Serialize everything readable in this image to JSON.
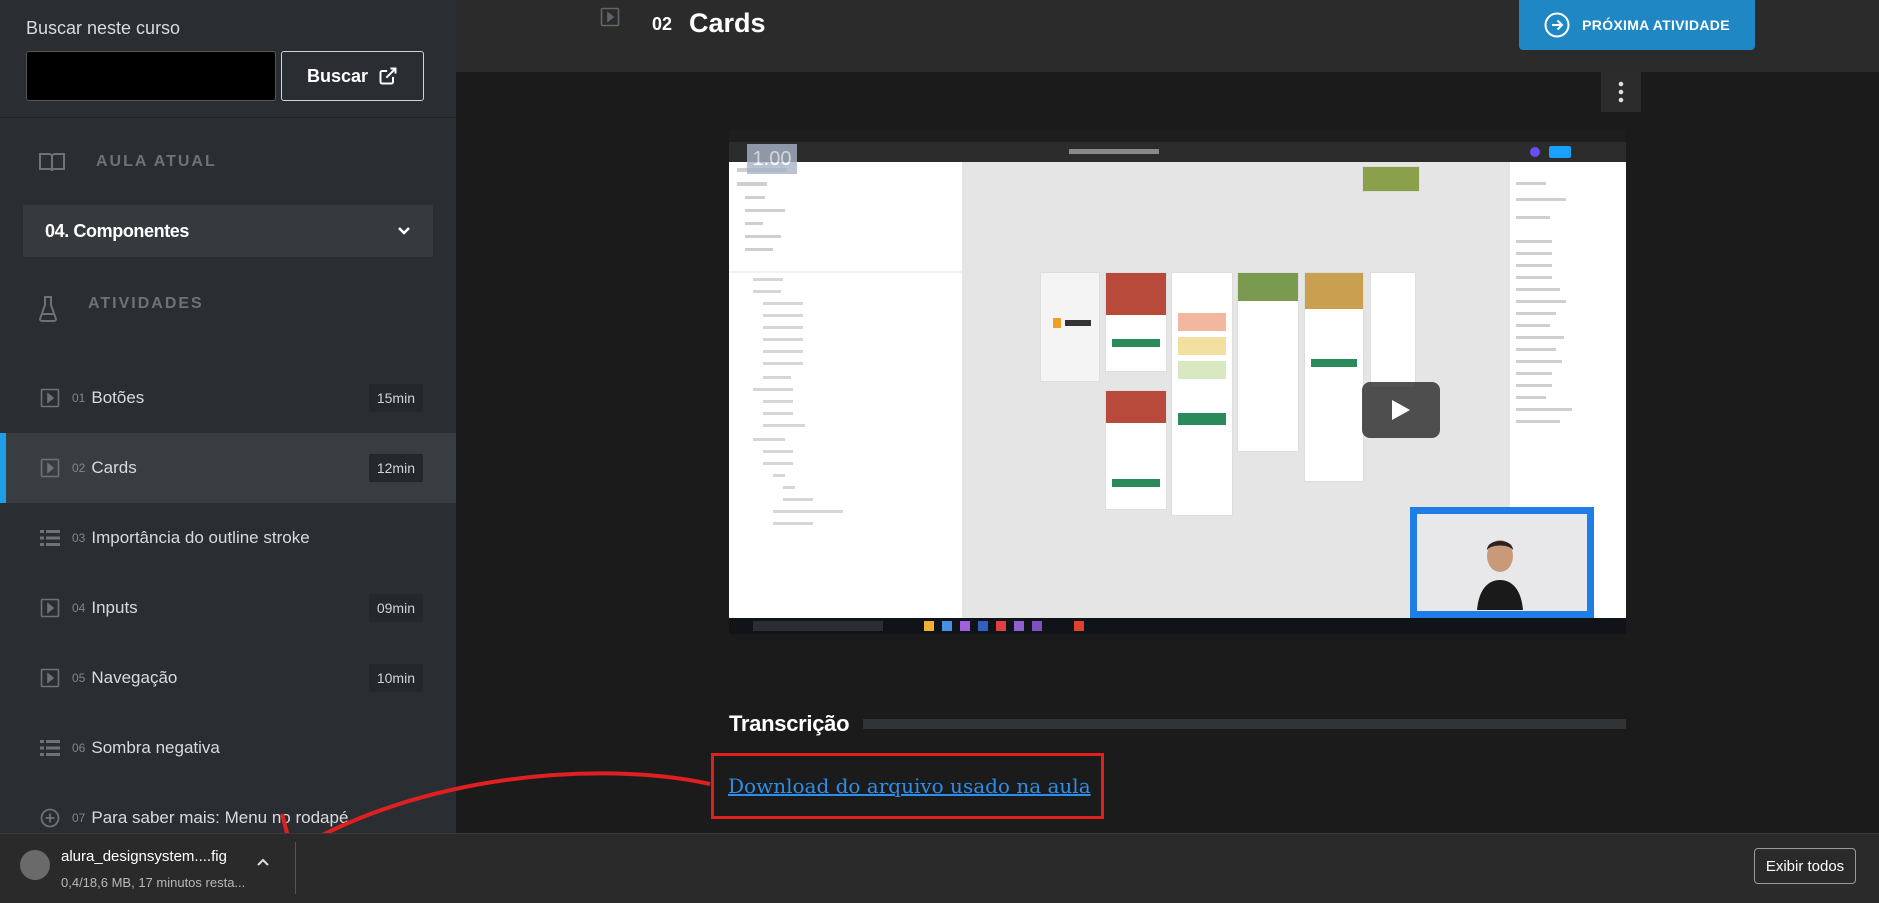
{
  "sidebar": {
    "search_label": "Buscar neste curso",
    "search_placeholder": "",
    "search_button": "Buscar",
    "aula_atual_label": "AULA ATUAL",
    "current_lesson": "04. Componentes",
    "atividades_label": "ATIVIDADES",
    "items": [
      {
        "num": "01",
        "title": "Botões",
        "duration": "15min",
        "icon": "play-icon"
      },
      {
        "num": "02",
        "title": "Cards",
        "duration": "12min",
        "icon": "play-icon"
      },
      {
        "num": "03",
        "title": "Importância do outline stroke",
        "duration": "",
        "icon": "list-icon"
      },
      {
        "num": "04",
        "title": "Inputs",
        "duration": "09min",
        "icon": "play-icon"
      },
      {
        "num": "05",
        "title": "Navegação",
        "duration": "10min",
        "icon": "play-icon"
      },
      {
        "num": "06",
        "title": "Sombra negativa",
        "duration": "",
        "icon": "list-icon"
      },
      {
        "num": "07",
        "title": "Para saber mais: Menu no rodapé",
        "duration": "",
        "icon": "plus-circle-icon"
      }
    ]
  },
  "header": {
    "lesson_num": "02",
    "lesson_title": "Cards",
    "next_button": "PRÓXIMA ATIVIDADE"
  },
  "video": {
    "speed": "1.00"
  },
  "content": {
    "transcricao_label": "Transcrição",
    "download_link": "Download do arquivo usado na aula"
  },
  "downloads": {
    "file_name": "alura_designsystem....fig",
    "status": "0,4/18,6 MB, 17 minutos resta...",
    "show_all": "Exibir todos"
  },
  "colors": {
    "accent": "#1f87c4",
    "active_bar": "#1e9ee8",
    "highlight_box": "#e02020",
    "link": "#2c8ee8"
  }
}
